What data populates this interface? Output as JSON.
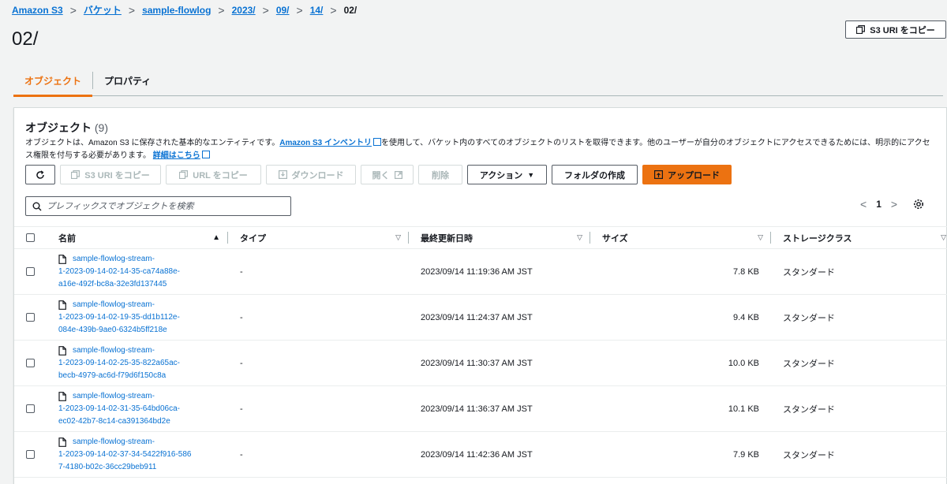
{
  "breadcrumb": [
    "Amazon S3",
    "バケット",
    "sample-flowlog",
    "2023/",
    "09/",
    "14/",
    "02/"
  ],
  "page_title": "02/",
  "copy_uri_label": "S3 URI をコピー",
  "tabs": [
    {
      "label": "オブジェクト",
      "active": true
    },
    {
      "label": "プロパティ",
      "active": false
    }
  ],
  "objects_panel": {
    "title": "オブジェクト",
    "count": "(9)",
    "desc_before": "オブジェクトは、Amazon S3 に保存された基本的なエンティティです。",
    "desc_link1": "Amazon S3 インベントリ",
    "desc_middle": "を使用して、バケット内のすべてのオブジェクトのリストを取得できます。他のユーザーが自分のオブジェクトにアクセスできるためには、明示的にアクセス権限を付与する必要があります。",
    "desc_link2": "詳細はこちら"
  },
  "toolbar": {
    "copy_s3_uri": "S3 URI をコピー",
    "copy_url": "URL をコピー",
    "download": "ダウンロード",
    "open": "開く",
    "delete": "削除",
    "actions": "アクション",
    "create_folder": "フォルダの作成",
    "upload": "アップロード"
  },
  "search": {
    "placeholder": "プレフィックスでオブジェクトを検索"
  },
  "pagination": {
    "page": "1"
  },
  "columns": [
    "名前",
    "タイプ",
    "最終更新日時",
    "サイズ",
    "ストレージクラス"
  ],
  "rows": [
    {
      "name": [
        "sample-flowlog-stream-",
        "1-2023-09-14-02-14-35-ca74a88e-",
        "a16e-492f-bc8a-32e3fd137445"
      ],
      "type": "-",
      "modified": "2023/09/14 11:19:36 AM JST",
      "size": "7.8 KB",
      "storage": "スタンダード"
    },
    {
      "name": [
        "sample-flowlog-stream-",
        "1-2023-09-14-02-19-35-dd1b112e-",
        "084e-439b-9ae0-6324b5ff218e"
      ],
      "type": "-",
      "modified": "2023/09/14 11:24:37 AM JST",
      "size": "9.4 KB",
      "storage": "スタンダード"
    },
    {
      "name": [
        "sample-flowlog-stream-",
        "1-2023-09-14-02-25-35-822a65ac-",
        "becb-4979-ac6d-f79d6f150c8a"
      ],
      "type": "-",
      "modified": "2023/09/14 11:30:37 AM JST",
      "size": "10.0 KB",
      "storage": "スタンダード"
    },
    {
      "name": [
        "sample-flowlog-stream-",
        "1-2023-09-14-02-31-35-64bd06ca-",
        "ec02-42b7-8c14-ca391364bd2e"
      ],
      "type": "-",
      "modified": "2023/09/14 11:36:37 AM JST",
      "size": "10.1 KB",
      "storage": "スタンダード"
    },
    {
      "name": [
        "sample-flowlog-stream-",
        "1-2023-09-14-02-37-34-5422f916-586",
        "7-4180-b02c-36cc29beb911"
      ],
      "type": "-",
      "modified": "2023/09/14 11:42:36 AM JST",
      "size": "7.9 KB",
      "storage": "スタンダード"
    }
  ],
  "colors": {
    "accent": "#ec7211",
    "link": "#0972d3",
    "text": "#16191f",
    "background": "#f2f3f3"
  }
}
